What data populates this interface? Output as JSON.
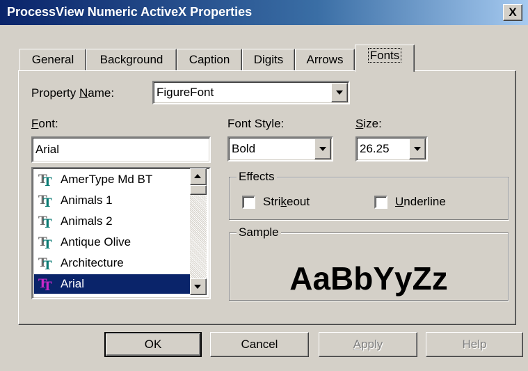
{
  "window": {
    "title": "ProcessView Numeric ActiveX Properties",
    "close_label": "X"
  },
  "tabs": [
    {
      "label": "General"
    },
    {
      "label": "Background"
    },
    {
      "label": "Caption"
    },
    {
      "label": "Digits"
    },
    {
      "label": "Arrows"
    },
    {
      "label": "Fonts",
      "active": true
    }
  ],
  "property": {
    "label_prefix": "Property ",
    "label_key": "N",
    "label_rest": "ame:",
    "value": "FigureFont"
  },
  "font": {
    "label_key": "F",
    "label_rest": "ont:",
    "value": "Arial",
    "list": [
      {
        "name": "AmerType Md BT"
      },
      {
        "name": "Animals 1"
      },
      {
        "name": "Animals 2"
      },
      {
        "name": "Antique Olive"
      },
      {
        "name": "Architecture"
      },
      {
        "name": "Arial",
        "selected": true
      }
    ]
  },
  "font_style": {
    "label": "Font Style:",
    "value": "Bold"
  },
  "size": {
    "label_key": "S",
    "label_rest": "ize:",
    "value": "26.25"
  },
  "effects": {
    "legend": "Effects",
    "strikeout": {
      "label_pre": "Stri",
      "label_key": "k",
      "label_post": "eout",
      "checked": false
    },
    "underline": {
      "label_key": "U",
      "label_rest": "nderline",
      "checked": false
    }
  },
  "sample": {
    "legend": "Sample",
    "text": "AaBbYyZz"
  },
  "buttons": {
    "ok": "OK",
    "cancel": "Cancel",
    "apply_key": "A",
    "apply_rest": "pply",
    "help": "Help"
  }
}
